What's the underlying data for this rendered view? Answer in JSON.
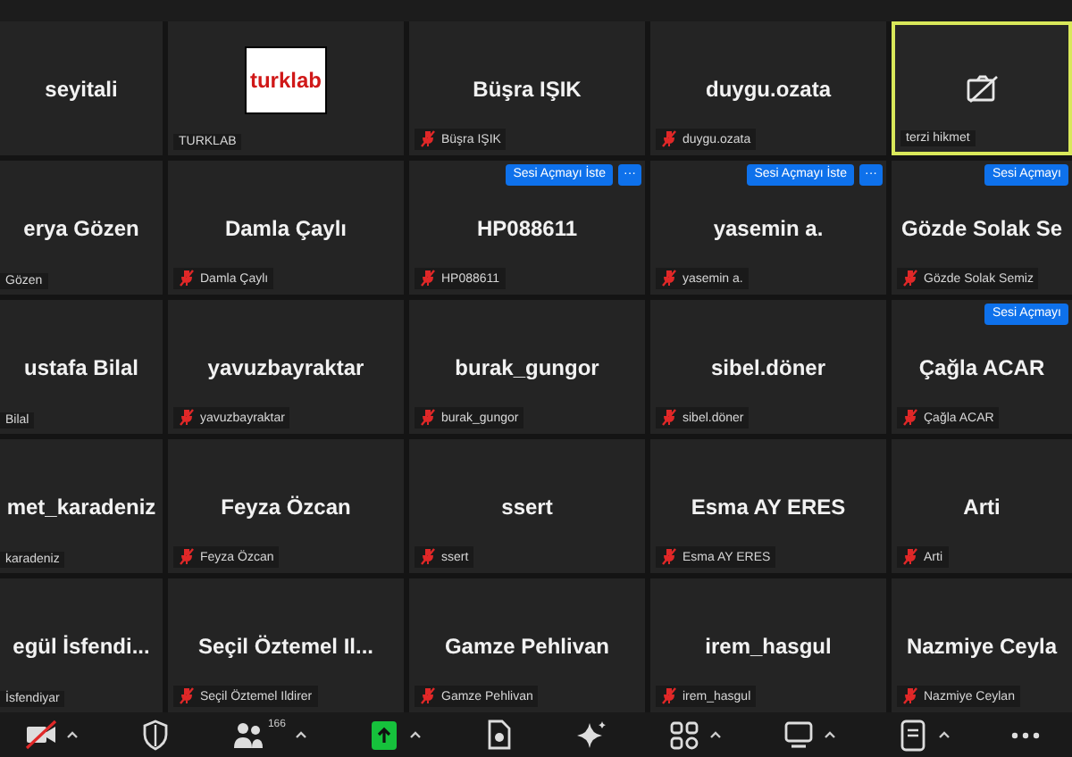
{
  "gallery": [
    {
      "kind": "name",
      "name": "seyitali",
      "active": false
    },
    {
      "kind": "logo",
      "logo_text": "turklab",
      "label": "TURKLAB",
      "muted": false,
      "active": false
    },
    {
      "kind": "name",
      "name": "Büşra IŞIK",
      "label": "Büşra IŞIK",
      "muted": true,
      "active": false
    },
    {
      "kind": "name",
      "name": "duygu.ozata",
      "label": "duygu.ozata",
      "muted": true,
      "active": false
    },
    {
      "kind": "camera_off",
      "label": "terzi hikmet",
      "muted": false,
      "active": true
    },
    {
      "kind": "name",
      "name": "erya Gözen",
      "label": "Gözen",
      "muted": false,
      "active": false
    },
    {
      "kind": "name",
      "name": "Damla Çaylı",
      "label": "Damla Çaylı",
      "muted": true,
      "active": false
    },
    {
      "kind": "name",
      "name": "HP088611",
      "label": "HP088611",
      "muted": true,
      "active": false,
      "request_button": "Sesi Açmayı İste",
      "more_button": "···"
    },
    {
      "kind": "name",
      "name": "yasemin a.",
      "label": "yasemin a.",
      "muted": true,
      "active": false,
      "request_button": "Sesi Açmayı İste",
      "more_button": "···"
    },
    {
      "kind": "name",
      "name": "Gözde Solak Se",
      "label": "Gözde Solak Semiz",
      "muted": true,
      "active": false,
      "request_button": "Sesi Açmayı"
    },
    {
      "kind": "name",
      "name": "ustafa Bilal",
      "label": "Bilal",
      "muted": false,
      "active": false
    },
    {
      "kind": "name",
      "name": "yavuzbayraktar",
      "label": "yavuzbayraktar",
      "muted": true,
      "active": false
    },
    {
      "kind": "name",
      "name": "burak_gungor",
      "label": "burak_gungor",
      "muted": true,
      "active": false
    },
    {
      "kind": "name",
      "name": "sibel.döner",
      "label": "sibel.döner",
      "muted": true,
      "active": false
    },
    {
      "kind": "name",
      "name": "Çağla ACAR",
      "label": "Çağla ACAR",
      "muted": true,
      "active": false,
      "request_button": "Sesi Açmayı"
    },
    {
      "kind": "name",
      "name": "met_karadeniz",
      "label": "karadeniz",
      "muted": false,
      "active": false
    },
    {
      "kind": "name",
      "name": "Feyza Özcan",
      "label": "Feyza Özcan",
      "muted": true,
      "active": false
    },
    {
      "kind": "name",
      "name": "ssert",
      "label": "ssert",
      "muted": true,
      "active": false
    },
    {
      "kind": "name",
      "name": "Esma AY ERES",
      "label": "Esma AY ERES",
      "muted": true,
      "active": false
    },
    {
      "kind": "name",
      "name": "Arti",
      "label": "Arti",
      "muted": true,
      "active": false
    },
    {
      "kind": "name",
      "name": "egül İsfendi...",
      "label": "İsfendiyar",
      "muted": false,
      "active": false
    },
    {
      "kind": "name",
      "name": "Seçil Öztemel Il...",
      "label": "Seçil Öztemel Ildirer",
      "muted": true,
      "active": false
    },
    {
      "kind": "name",
      "name": "Gamze Pehlivan",
      "label": "Gamze Pehlivan",
      "muted": true,
      "active": false
    },
    {
      "kind": "name",
      "name": "irem_hasgul",
      "label": "irem_hasgul",
      "muted": true,
      "active": false
    },
    {
      "kind": "name",
      "name": "Nazmiye Ceyla",
      "label": "Nazmiye Ceylan",
      "muted": true,
      "active": false
    }
  ],
  "toolbar": [
    {
      "kind": "video_off",
      "caret": true
    },
    {
      "kind": "security",
      "caret": false
    },
    {
      "kind": "participants",
      "count": "166",
      "caret": true
    },
    {
      "kind": "share",
      "caret": true
    },
    {
      "kind": "record",
      "caret": false
    },
    {
      "kind": "ai",
      "caret": false
    },
    {
      "kind": "apps",
      "caret": true
    },
    {
      "kind": "whiteboard",
      "caret": true
    },
    {
      "kind": "notes",
      "caret": true
    },
    {
      "kind": "more",
      "caret": false
    }
  ]
}
